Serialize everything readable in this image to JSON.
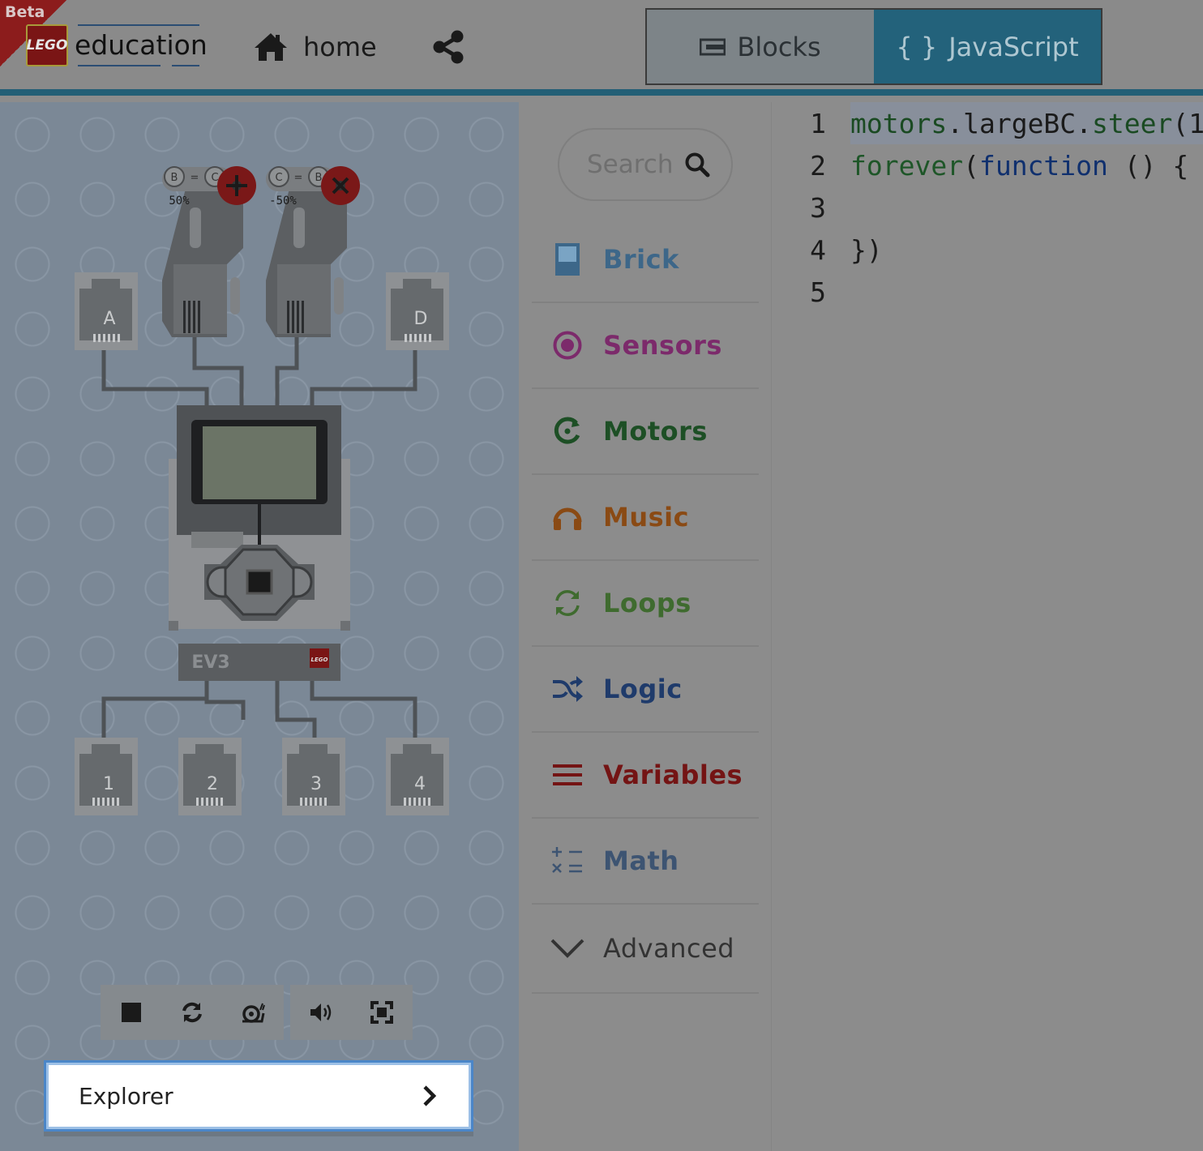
{
  "header": {
    "beta_label": "Beta",
    "logo_text": "LEGO",
    "brand_text": "education",
    "home_label": "home",
    "blocks_label": "Blocks",
    "javascript_label": "JavaScript",
    "javascript_icon": "{ }"
  },
  "simulator": {
    "ports_top": [
      "A",
      "D"
    ],
    "ports_bottom": [
      "1",
      "2",
      "3",
      "4"
    ],
    "motor_b": {
      "label_left": "B",
      "label_right": "C",
      "speed": "50%"
    },
    "motor_c": {
      "label_left": "C",
      "label_right": "B",
      "speed": "-50%"
    },
    "brick_model": "EV3",
    "brick_badge": "LEGO",
    "controls": [
      "stop-icon",
      "restart-icon",
      "slow-motion-icon",
      "sound-icon",
      "fullscreen-icon"
    ],
    "explorer_label": "Explorer"
  },
  "toolbox": {
    "search_placeholder": "Search",
    "categories": [
      {
        "label": "Brick",
        "icon": "brick-icon",
        "color": "#3d6789"
      },
      {
        "label": "Sensors",
        "icon": "sensors-icon",
        "color": "#7c2a6b"
      },
      {
        "label": "Motors",
        "icon": "motors-icon",
        "color": "#1d4f25"
      },
      {
        "label": "Music",
        "icon": "music-icon",
        "color": "#8a4a14"
      },
      {
        "label": "Loops",
        "icon": "loops-icon",
        "color": "#3f6b2f"
      },
      {
        "label": "Logic",
        "icon": "logic-icon",
        "color": "#1f3b6b"
      },
      {
        "label": "Variables",
        "icon": "variables-icon",
        "color": "#741414"
      },
      {
        "label": "Math",
        "icon": "math-icon",
        "color": "#3d5472"
      },
      {
        "label": "Advanced",
        "icon": "chevron-down-icon",
        "color": "#333333"
      }
    ]
  },
  "editor": {
    "lines": [
      {
        "num": "1",
        "tokens": [
          [
            "motors",
            "#1a4a22"
          ],
          [
            ".",
            "#1a1a1a"
          ],
          [
            "largeBC",
            "#1a1a1a"
          ],
          [
            ".",
            "#1a1a1a"
          ],
          [
            "steer",
            "#1a4a22"
          ],
          [
            "(1",
            "#1a1a1a"
          ]
        ]
      },
      {
        "num": "2",
        "tokens": [
          [
            "forever",
            "#1e5628"
          ],
          [
            "(",
            "#1a1a1a"
          ],
          [
            "function",
            "#10306e"
          ],
          [
            " () {",
            "#1a1a1a"
          ]
        ]
      },
      {
        "num": "3",
        "tokens": []
      },
      {
        "num": "4",
        "tokens": [
          [
            "})",
            "#1a1a1a"
          ]
        ]
      },
      {
        "num": "5",
        "tokens": []
      }
    ]
  }
}
